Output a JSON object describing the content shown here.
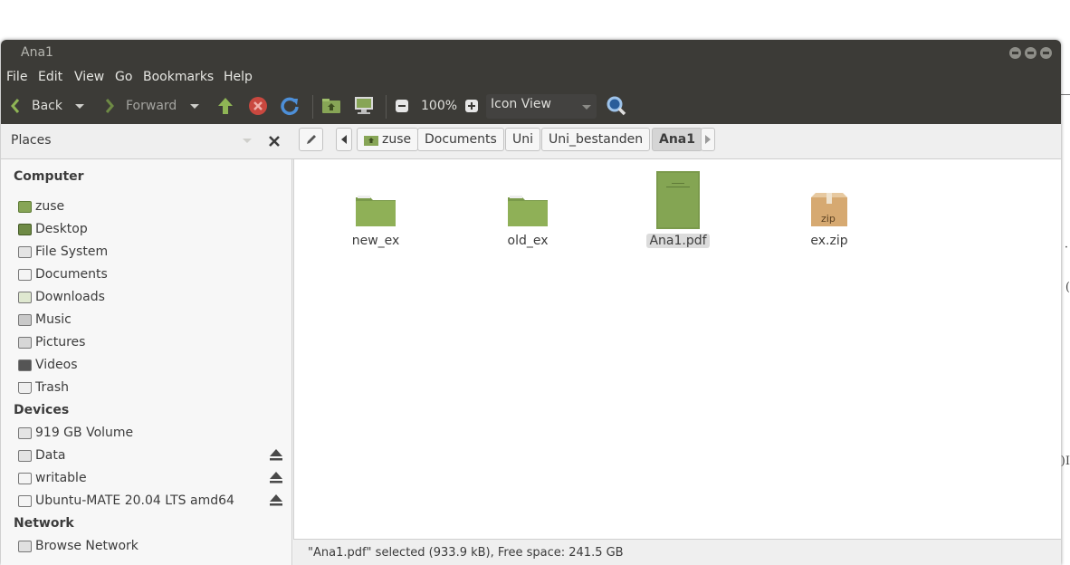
{
  "window": {
    "title": "Ana1"
  },
  "menubar": [
    "File",
    "Edit",
    "View",
    "Go",
    "Bookmarks",
    "Help"
  ],
  "toolbar": {
    "back_label": "Back",
    "forward_label": "Forward",
    "zoom": "100%",
    "view_mode": "Icon View"
  },
  "location": {
    "panel_label": "Places",
    "breadcrumbs": [
      "zuse",
      "Documents",
      "Uni",
      "Uni_bestanden",
      "Ana1"
    ],
    "active_crumb": "Ana1"
  },
  "sidebar": {
    "computer_heading": "Computer",
    "computer": [
      {
        "label": "zuse",
        "icon": "home-folder-icon"
      },
      {
        "label": "Desktop",
        "icon": "desktop-icon"
      },
      {
        "label": "File System",
        "icon": "drive-icon"
      },
      {
        "label": "Documents",
        "icon": "documents-icon"
      },
      {
        "label": "Downloads",
        "icon": "downloads-icon"
      },
      {
        "label": "Music",
        "icon": "music-icon"
      },
      {
        "label": "Pictures",
        "icon": "pictures-icon"
      },
      {
        "label": "Videos",
        "icon": "videos-icon"
      },
      {
        "label": "Trash",
        "icon": "trash-icon"
      }
    ],
    "devices_heading": "Devices",
    "devices": [
      {
        "label": "919 GB Volume",
        "icon": "drive-icon"
      },
      {
        "label": "Data",
        "icon": "drive-icon"
      },
      {
        "label": "writable",
        "icon": "usb-drive-icon"
      },
      {
        "label": "Ubuntu-MATE 20.04 LTS amd64",
        "icon": "usb-drive-icon"
      }
    ],
    "network_heading": "Network",
    "network": [
      {
        "label": "Browse Network",
        "icon": "network-icon"
      }
    ]
  },
  "files": [
    {
      "name": "new_ex",
      "type": "folder",
      "icon": "folder-icon"
    },
    {
      "name": "old_ex",
      "type": "folder",
      "icon": "folder-icon"
    },
    {
      "name": "Ana1.pdf",
      "type": "pdf",
      "icon": "pdf-document-icon",
      "selected": true
    },
    {
      "name": "ex.zip",
      "type": "zip",
      "icon": "zip-archive-icon",
      "badge": "zip"
    }
  ],
  "status": "\"Ana1.pdf\" selected (933.9 kB), Free space: 241.5 GB",
  "colors": {
    "accent": "#87a556",
    "titlebar": "#3c3b37",
    "selection": "#dcdcdc"
  }
}
